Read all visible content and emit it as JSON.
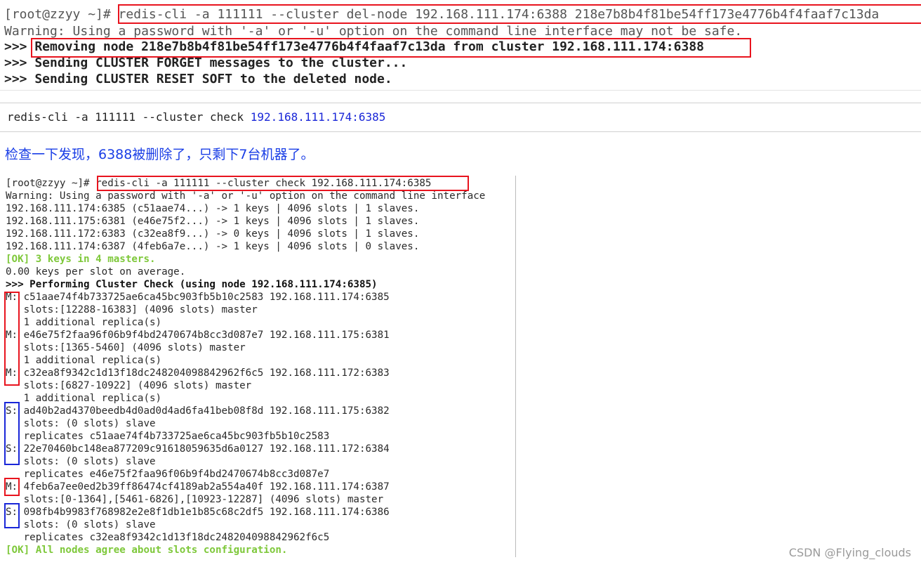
{
  "term1": {
    "lines": [
      {
        "prompt": "[root@zzyy ~]# ",
        "cmd": "redis-cli -a 111111 --cluster del-node 192.168.111.174:6388 218e7b8b4f81be54ff173e4776b4f4faaf7c13da"
      },
      {
        "text": "Warning: Using a password with '-a' or '-u' option on the command line interface may not be safe."
      },
      {
        "text": ">>> Removing node 218e7b8b4f81be54ff173e4776b4f4faaf7c13da from cluster 192.168.111.174:6388"
      },
      {
        "text": ">>> Sending CLUSTER FORGET messages to the cluster..."
      },
      {
        "text": ">>> Sending CLUSTER RESET SOFT to the deleted node."
      }
    ]
  },
  "cmdbar": {
    "prefix": "redis-cli -a 111111 --cluster check ",
    "ip": "192.168.111.174:6385"
  },
  "note": "检查一下发现，6388被删除了，只剩下7台机器了。",
  "term2": {
    "lines": [
      "[root@zzyy ~]# redis-cli -a 111111 --cluster check 192.168.111.174:6385",
      "Warning: Using a password with '-a' or '-u' option on the command line interface",
      "192.168.111.174:6385 (c51aae74...) -> 1 keys | 4096 slots | 1 slaves.",
      "192.168.111.175:6381 (e46e75f2...) -> 1 keys | 4096 slots | 1 slaves.",
      "192.168.111.172:6383 (c32ea8f9...) -> 0 keys | 4096 slots | 1 slaves.",
      "192.168.111.174:6387 (4feb6a7e...) -> 1 keys | 4096 slots | 0 slaves.",
      "[OK] 3 keys in 4 masters.",
      "0.00 keys per slot on average.",
      ">>> Performing Cluster Check (using node 192.168.111.174:6385)",
      "M: c51aae74f4b733725ae6ca45bc903fb5b10c2583 192.168.111.174:6385",
      "   slots:[12288-16383] (4096 slots) master",
      "   1 additional replica(s)",
      "M: e46e75f2faa96f06b9f4bd2470674b8cc3d087e7 192.168.111.175:6381",
      "   slots:[1365-5460] (4096 slots) master",
      "   1 additional replica(s)",
      "M: c32ea8f9342c1d13f18dc248204098842962f6c5 192.168.111.172:6383",
      "   slots:[6827-10922] (4096 slots) master",
      "   1 additional replica(s)",
      "S: ad40b2ad4370beedb4d0ad0d4ad6fa41beb08f8d 192.168.111.175:6382",
      "   slots: (0 slots) slave",
      "   replicates c51aae74f4b733725ae6ca45bc903fb5b10c2583",
      "S: 22e70460bc148ea877209c91618059635d6a0127 192.168.111.172:6384",
      "   slots: (0 slots) slave",
      "   replicates e46e75f2faa96f06b9f4bd2470674b8cc3d087e7",
      "M: 4feb6a7ee0ed2b39ff86474cf4189ab2a554a40f 192.168.111.174:6387",
      "   slots:[0-1364],[5461-6826],[10923-12287] (4096 slots) master",
      "S: 098fb4b9983f768982e2e8f1db1e1b85c68c2df5 192.168.111.174:6386",
      "   slots: (0 slots) slave",
      "   replicates c32ea8f9342c1d13f18dc248204098842962f6c5",
      "[OK] All nodes agree about slots configuration."
    ]
  },
  "watermark": "CSDN @Flying_clouds",
  "colors": {
    "highlight_red": "#e8141e",
    "highlight_blue": "#1a27d8",
    "ok_green": "#7ec83a",
    "note_blue": "#1a3ee6"
  }
}
